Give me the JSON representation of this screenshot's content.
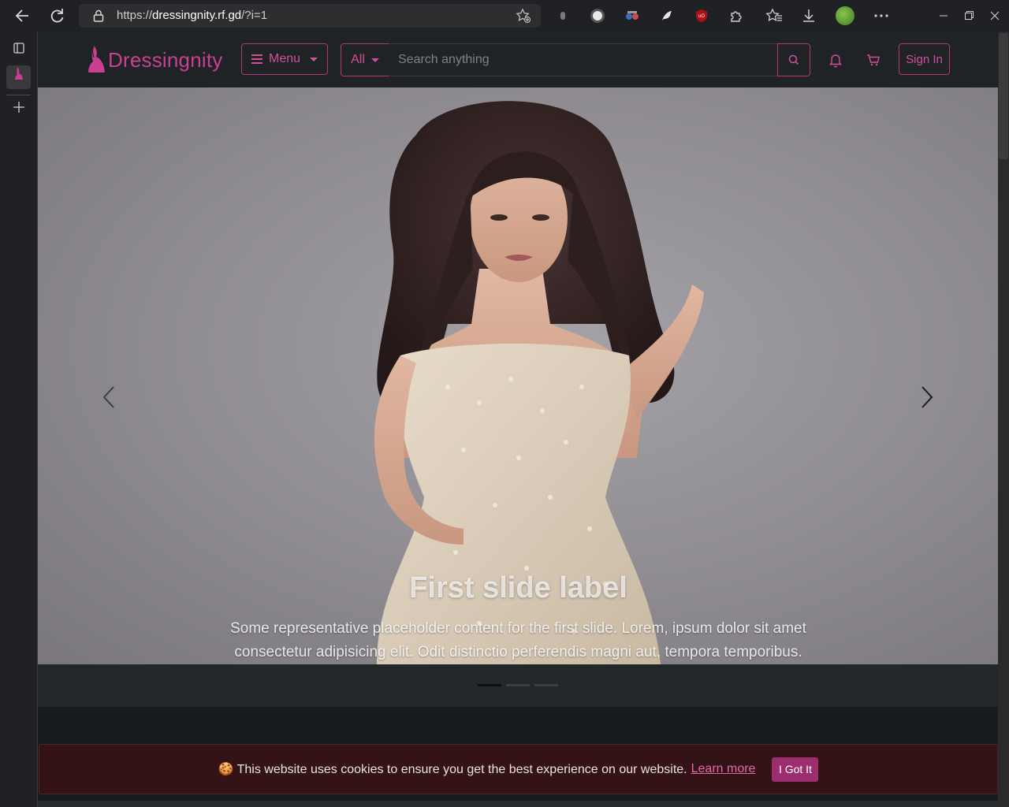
{
  "browser": {
    "url_scheme": "https://",
    "url_host": "dressingnity.rf.gd",
    "url_path": "/?i=1",
    "icons": [
      "back-icon",
      "refresh-icon",
      "lock-icon",
      "add-favorite-icon",
      "extension-icon",
      "puzzle-icon",
      "favorites-icon",
      "downloads-icon",
      "profile-icon",
      "more-icon",
      "minimize-icon",
      "maximize-icon",
      "close-icon"
    ]
  },
  "site": {
    "brand": "Dressingnity",
    "brand_color": "#c8408f",
    "menu_label": "Menu",
    "category_label": "All",
    "search_placeholder": "Search anything",
    "signin_label": "Sign In"
  },
  "carousel": {
    "title": "First slide label",
    "text": "Some representative placeholder content for the first slide. Lorem, ipsum dolor sit amet consectetur adipisicing elit. Odit distinctio perferendis magni aut, tempora temporibus.",
    "slides": 3,
    "active_slide": 1
  },
  "cookie": {
    "message": "🍪 This website uses cookies to ensure you get the best experience on our website.",
    "learn_more": "Learn more",
    "button": "I Got It"
  }
}
